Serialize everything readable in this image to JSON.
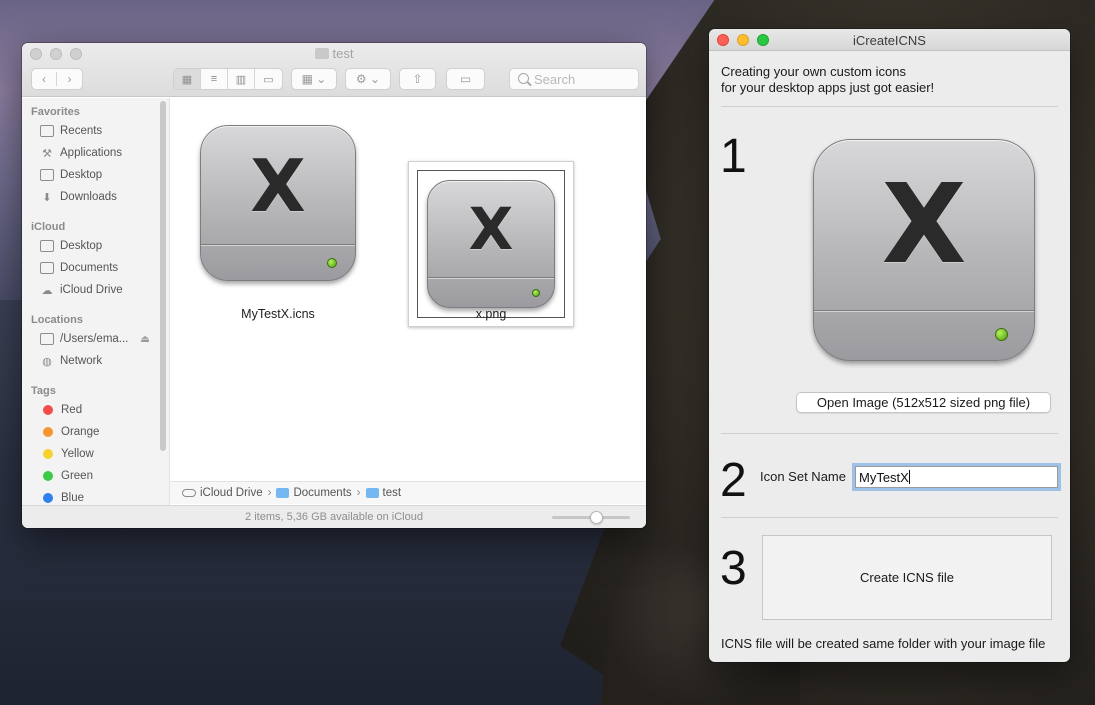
{
  "finder": {
    "title": "test",
    "search_placeholder": "Search",
    "sidebar": {
      "favorites_header": "Favorites",
      "favorites": [
        "Recents",
        "Applications",
        "Desktop",
        "Downloads"
      ],
      "icloud_header": "iCloud",
      "icloud": [
        "Desktop",
        "Documents",
        "iCloud Drive"
      ],
      "locations_header": "Locations",
      "locations": [
        "/Users/ema...",
        "Network"
      ],
      "tags_header": "Tags",
      "tags": [
        {
          "label": "Red",
          "color": "#f24f4a"
        },
        {
          "label": "Orange",
          "color": "#f5972f"
        },
        {
          "label": "Yellow",
          "color": "#f8d131"
        },
        {
          "label": "Green",
          "color": "#3ec94b"
        },
        {
          "label": "Blue",
          "color": "#2f7ff0"
        }
      ]
    },
    "files": [
      {
        "name": "MyTestX.icns",
        "glyph": "X"
      },
      {
        "name": "x.png",
        "glyph": "X"
      }
    ],
    "path": [
      "iCloud Drive",
      "Documents",
      "test"
    ],
    "status": "2 items, 5,36 GB available on iCloud"
  },
  "app": {
    "title": "iCreateICNS",
    "intro_line1": "Creating your own custom icons",
    "intro_line2": "for your desktop apps just got easier!",
    "step1": "1",
    "step2": "2",
    "step3": "3",
    "preview_glyph": "X",
    "open_button": "Open Image (512x512 sized png file)",
    "icon_set_label": "Icon Set Name",
    "icon_set_value": "MyTestX",
    "create_button": "Create ICNS file",
    "footer": "ICNS file will be created same folder with your image file"
  }
}
